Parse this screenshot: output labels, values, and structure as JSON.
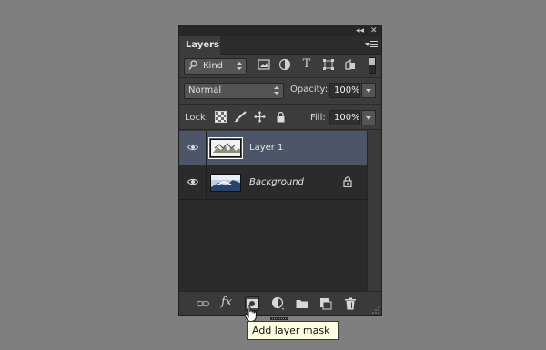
{
  "panel": {
    "collapse_label": "◂◂",
    "close_label": "✕",
    "tab_label": "Layers"
  },
  "filter": {
    "kind_label": "Kind",
    "icons": [
      "image-filter-icon",
      "adjustment-filter-icon",
      "type-filter-icon",
      "shape-filter-icon",
      "smart-object-filter-icon"
    ],
    "type_glyph": "T"
  },
  "blend": {
    "mode": "Normal",
    "opacity_label": "Opacity:",
    "opacity_value": "100%"
  },
  "lock": {
    "label": "Lock:",
    "fill_label": "Fill:",
    "fill_value": "100%"
  },
  "layers": [
    {
      "name": "Layer 1",
      "selected": true
    },
    {
      "name": "Background",
      "selected": false,
      "locked": true
    }
  ],
  "footer": {
    "fx_label": "fx",
    "buttons": [
      "link-layers",
      "fx",
      "add-layer-mask",
      "new-fill-adjustment",
      "new-group",
      "new-layer",
      "delete"
    ]
  },
  "tooltip": {
    "text": "Add layer mask"
  },
  "colors": {
    "background": "#7f7f7f",
    "panel": "#3c3c3c",
    "selection": "#4d5568",
    "tooltip_bg": "#ffffe1"
  }
}
